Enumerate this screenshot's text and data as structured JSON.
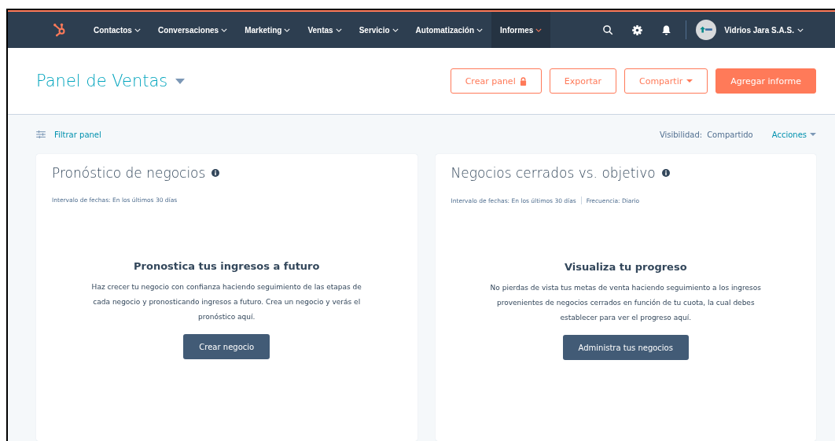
{
  "nav": {
    "items": [
      {
        "label": "Contactos",
        "selected": false
      },
      {
        "label": "Conversaciones",
        "selected": false
      },
      {
        "label": "Marketing",
        "selected": false
      },
      {
        "label": "Ventas",
        "selected": false
      },
      {
        "label": "Servicio",
        "selected": false
      },
      {
        "label": "Automatización",
        "selected": false
      },
      {
        "label": "Informes",
        "selected": true
      }
    ],
    "account": "Vidrios Jara S.A.S."
  },
  "header": {
    "title": "Panel de Ventas",
    "buttons": [
      {
        "label": "Crear panel",
        "kind": "locked"
      },
      {
        "label": "Exportar",
        "kind": "outline"
      },
      {
        "label": "Compartir",
        "kind": "dropdown"
      },
      {
        "label": "Agregar informe",
        "kind": "primary"
      }
    ]
  },
  "toolbar": {
    "filter": "Filtrar panel",
    "visibility_label": "Visibilidad:",
    "visibility_value": "Compartido",
    "actions": "Acciones"
  },
  "cards": [
    {
      "title": "Pronóstico de negocios",
      "meta": [
        "Intervalo de fechas: En los últimos 30 días"
      ],
      "heading": "Pronostica tus ingresos a futuro",
      "body": "Haz crecer tu negocio con confianza haciendo seguimiento de las etapas de cada negocio y pronosticando ingresos a futuro. Crea un negocio y verás el pronóstico aquí.",
      "button": "Crear negocio"
    },
    {
      "title": "Negocios cerrados vs. objetivo",
      "meta": [
        "Intervalo de fechas: En los últimos 30 días",
        "Frecuencia: Diario"
      ],
      "heading": "Visualiza tu progreso",
      "body": "No pierdas de vista tus metas de venta haciendo seguimiento a los ingresos provenientes de negocios cerrados en función de tu cuota, la cual debes establecer para ver el progreso aquí.",
      "button": "Administra tus negocios"
    }
  ]
}
